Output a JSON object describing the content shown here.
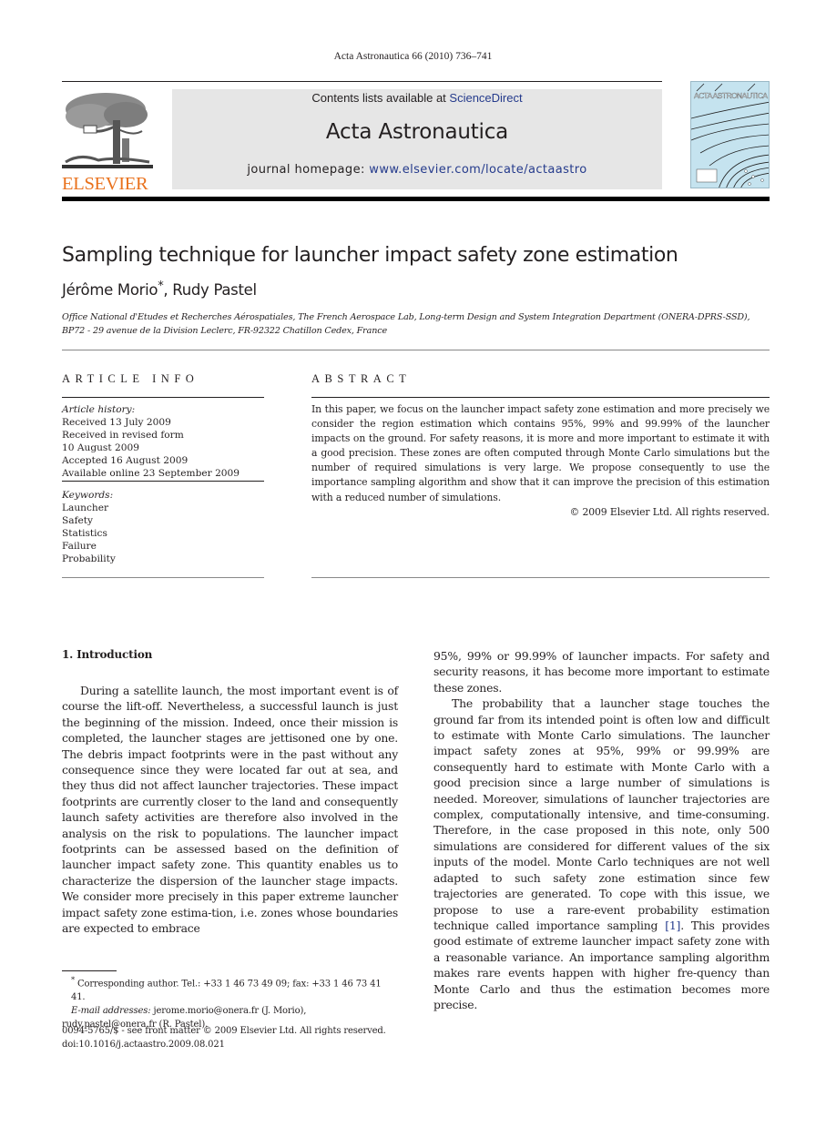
{
  "running_head": "Acta Astronautica 66 (2010) 736–741",
  "header": {
    "publisher_logo_text": "ELSEVIER",
    "contents_prefix": "Contents lists available at ",
    "contents_link": "ScienceDirect",
    "journal_name": "Acta Astronautica",
    "homepage_prefix": "journal homepage: ",
    "homepage_link": "www.elsevier.com/locate/actaastro",
    "cover_title": "ACTA ASTRONAUTICA",
    "colors": {
      "logo_orange": "#e9711c",
      "link_blue": "#253b8c",
      "banner_gray": "#e6e6e6",
      "cover_blue": "#c5e3ef"
    }
  },
  "article": {
    "title": "Sampling technique for launcher impact safety zone estimation",
    "authors": [
      {
        "name": "Jérôme Morio",
        "mark": "*"
      },
      {
        "name": "Rudy Pastel",
        "mark": ""
      }
    ],
    "author_separator": ", ",
    "affiliation_line1": "Office National d'Etudes et Recherches Aérospatiales, The French Aerospace Lab, Long-term Design and System Integration Department (ONERA-DPRS-SSD),",
    "affiliation_line2": "BP72 - 29 avenue de la Division Leclerc, FR-92322 Chatillon Cedex, France"
  },
  "article_info": {
    "heading": "ARTICLE INFO",
    "history_label": "Article history:",
    "history": [
      "Received 13 July 2009",
      "Received in revised form",
      "10 August 2009",
      "Accepted 16 August 2009",
      "Available online 23 September 2009"
    ],
    "keywords_label": "Keywords:",
    "keywords": [
      "Launcher",
      "Safety",
      "Statistics",
      "Failure",
      "Probability"
    ]
  },
  "abstract": {
    "heading": "ABSTRACT",
    "text": "In this paper, we focus on the launcher impact safety zone estimation and more precisely we consider the region estimation which contains 95%, 99% and 99.99% of the launcher impacts on the ground. For safety reasons, it is more and more important to estimate it with a good precision. These zones are often computed through Monte Carlo simulations but the number of required simulations is very large. We propose consequently to use the importance sampling algorithm and show that it can improve the precision of this estimation with a reduced number of simulations.",
    "copyright": "© 2009 Elsevier Ltd. All rights reserved."
  },
  "body": {
    "section_heading": "1.  Introduction",
    "left_paragraph": "During a satellite launch, the most important event is of course the lift-off. Nevertheless, a successful launch is just the beginning of the mission. Indeed, once their mission is completed, the launcher stages are jettisoned one by one. The debris impact footprints were in the past without any consequence since they were located far out at sea, and they thus did not affect launcher trajectories. These impact footprints are currently closer to the land and consequently launch safety activities are therefore also involved in the analysis on the risk to populations. The launcher impact footprints can be assessed based on the definition of launcher impact safety zone. This quantity enables us to characterize the dispersion of the launcher stage impacts. We consider more precisely in this paper extreme launcher impact safety zone estima-tion, i.e. zones whose boundaries are expected to embrace",
    "right_continuation": "95%, 99% or 99.99% of launcher impacts. For safety and security reasons, it has become more important to estimate these zones.",
    "right_paragraph_before_ref": "The probability that a launcher stage touches the ground far from its intended point is often low and difficult to estimate with Monte Carlo simulations. The launcher impact safety zones at 95%, 99% or 99.99% are consequently hard to estimate with Monte Carlo with a good precision since a large number of simulations is needed. Moreover, simulations of launcher trajectories are complex, computationally intensive, and time-consuming. Therefore, in the case proposed in this note, only 500 simulations are considered for different values of the six inputs of the model. Monte Carlo techniques are not well adapted to such safety zone estimation since few trajectories are generated. To cope with this issue, we propose to use a rare-event probability estimation technique called importance sampling ",
    "reference_link": "[1]",
    "right_paragraph_after_ref": ". This provides good estimate of extreme launcher impact safety zone with a reasonable variance. An importance sampling algorithm makes rare events happen with higher fre-quency than Monte Carlo and thus the estimation becomes more precise."
  },
  "footnotes": {
    "mark": "*",
    "corresponding": " Corresponding author. Tel.: +33 1 46 73 49 09; fax: +33 1 46 73 41 41.",
    "email_label": "E-mail addresses:",
    "email_1": " jerome.morio@onera.fr (J. Morio),",
    "email_2": "rudy.pastel@onera.fr (R. Pastel).",
    "front_matter": "0094-5765/$ - see front matter © 2009 Elsevier Ltd. All rights reserved.",
    "doi": "doi:10.1016/j.actaastro.2009.08.021"
  }
}
